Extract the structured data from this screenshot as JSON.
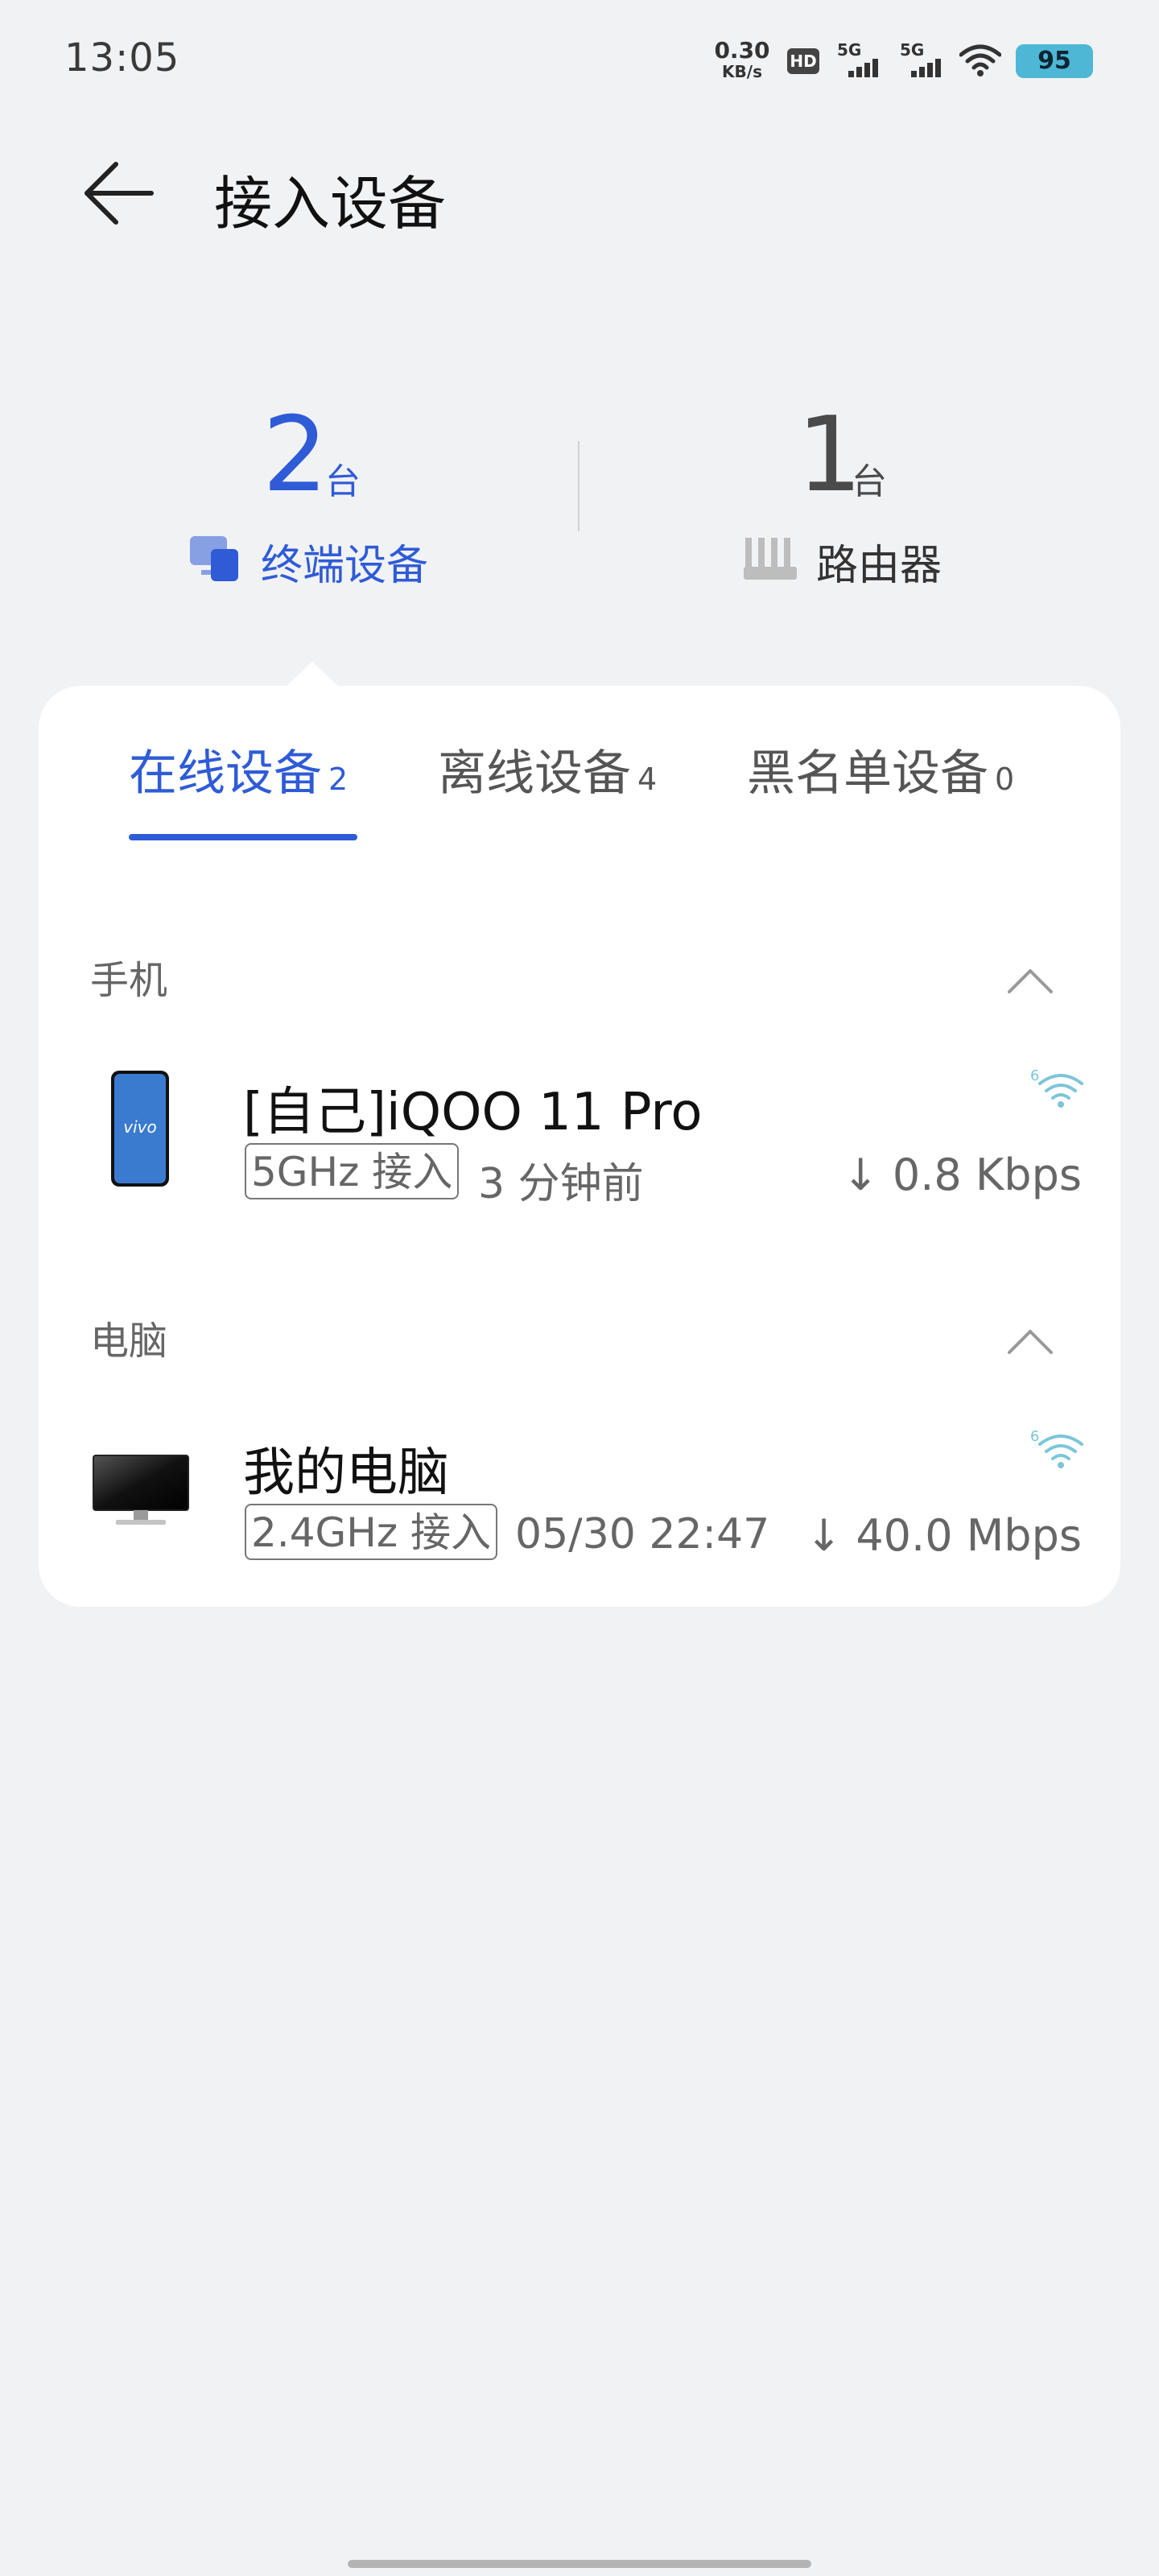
{
  "status_bar": {
    "time": "13:05",
    "net_speed_value": "0.30",
    "net_speed_unit": "KB/s",
    "hd": "HD",
    "sim1": "5G",
    "sim2": "5G",
    "battery": "95",
    "battery_color": "#4fb7d6"
  },
  "header": {
    "title": "接入设备",
    "back_icon": "arrow-left-icon"
  },
  "summary": {
    "terminal_count": "2",
    "terminal_unit": "台",
    "terminal_label": "终端设备",
    "router_count": "1",
    "router_unit": "台",
    "router_label": "路由器",
    "accent": "#2f5bd6"
  },
  "tabs": [
    {
      "label": "在线设备",
      "count": "2",
      "active": true
    },
    {
      "label": "离线设备",
      "count": "4",
      "active": false
    },
    {
      "label": "黑名单设备",
      "count": "0",
      "active": false
    }
  ],
  "groups": [
    {
      "label": "手机",
      "devices": [
        {
          "name": "[自己]iQOO 11 Pro",
          "band": "5GHz 接入",
          "time": "3 分钟前",
          "rate": "↓ 0.8 Kbps",
          "brand": "vivo",
          "icon": "phone-icon"
        }
      ]
    },
    {
      "label": "电脑",
      "devices": [
        {
          "name": "我的电脑",
          "band": "2.4GHz 接入",
          "time": "05/30 22:47",
          "rate": "↓ 40.0 Mbps",
          "icon": "monitor-icon"
        }
      ]
    }
  ]
}
